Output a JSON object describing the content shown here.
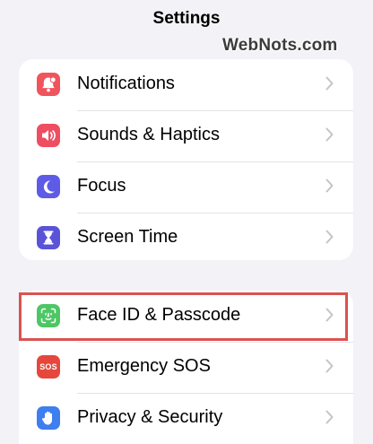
{
  "header": {
    "title": "Settings"
  },
  "watermark": "WebNots.com",
  "colors": {
    "background": "#f2f2f7",
    "notifications": "#f0545c",
    "sounds": "#ef4d62",
    "focus": "#5e5ce6",
    "screen_time": "#5a53d8",
    "face_id": "#4cc764",
    "emergency": "#e6473d",
    "privacy": "#3d7ef0",
    "highlight": "#d9534f"
  },
  "groups": [
    {
      "items": [
        {
          "label": "Notifications",
          "icon": "bell-icon"
        },
        {
          "label": "Sounds & Haptics",
          "icon": "speaker-icon"
        },
        {
          "label": "Focus",
          "icon": "moon-icon"
        },
        {
          "label": "Screen Time",
          "icon": "hourglass-icon"
        }
      ]
    },
    {
      "items": [
        {
          "label": "Face ID & Passcode",
          "icon": "face-id-icon"
        },
        {
          "label": "Emergency SOS",
          "icon": "sos-icon",
          "icon_text": "SOS"
        },
        {
          "label": "Privacy & Security",
          "icon": "hand-icon"
        }
      ]
    }
  ]
}
